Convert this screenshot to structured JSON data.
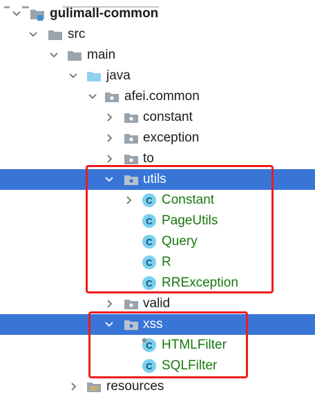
{
  "tree": {
    "project": "gulimall-common",
    "src": "src",
    "main": "main",
    "java": "java",
    "package": "afei.common",
    "constant": "constant",
    "exception": "exception",
    "to": "to",
    "utils": "utils",
    "utils_classes": [
      "Constant",
      "PageUtils",
      "Query",
      "R",
      "RRException"
    ],
    "valid": "valid",
    "xss": "xss",
    "xss_classes": [
      "HTMLFilter",
      "SQLFilter"
    ],
    "resources": "resources"
  },
  "colors": {
    "selection": "#3875d7",
    "highlight_box": "#ee1c1c",
    "class_text": "#17770e",
    "class_icon": "#7ad0f0",
    "folder": "#9aa4ae",
    "source_folder": "#8fd0ee"
  },
  "icons": {
    "expanded": "chevron-down-icon",
    "collapsed": "chevron-right-icon",
    "module": "module-folder-icon",
    "folder": "folder-icon",
    "source_folder": "source-folder-icon",
    "package": "package-icon",
    "class": "java-class-icon",
    "resources": "resources-folder-icon"
  }
}
